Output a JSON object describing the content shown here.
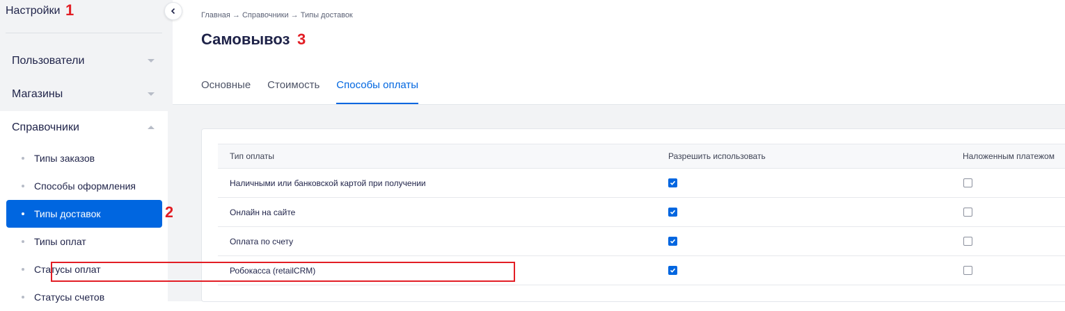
{
  "sidebar": {
    "title": "Настройки",
    "annotation_1": "1",
    "groups": [
      {
        "label": "Пользователи",
        "expanded": false
      },
      {
        "label": "Магазины",
        "expanded": false
      },
      {
        "label": "Справочники",
        "expanded": true
      }
    ],
    "subitems": [
      {
        "label": "Типы заказов",
        "active": false
      },
      {
        "label": "Способы оформления",
        "active": false
      },
      {
        "label": "Типы доставок",
        "active": true
      },
      {
        "label": "Типы оплат",
        "active": false
      },
      {
        "label": "Статусы оплат",
        "active": false
      },
      {
        "label": "Статусы счетов",
        "active": false
      }
    ],
    "annotation_2": "2",
    "collapse_icon": "chevron-left-icon"
  },
  "header": {
    "breadcrumb": "Главная → Справочники → Типы доставок",
    "title": "Самовывоз",
    "annotation_3": "3"
  },
  "tabs": [
    {
      "label": "Основные",
      "active": false
    },
    {
      "label": "Стоимость",
      "active": false
    },
    {
      "label": "Способы оплаты",
      "active": true
    }
  ],
  "table": {
    "columns": [
      "Тип оплаты",
      "Разрешить использовать",
      "Наложенным платежом"
    ],
    "rows": [
      {
        "name": "Наличными или банковской картой при получении",
        "allow": true,
        "cod": false
      },
      {
        "name": "Онлайн на сайте",
        "allow": true,
        "cod": false
      },
      {
        "name": "Оплата по счету",
        "allow": true,
        "cod": false
      },
      {
        "name": "Робокасса (retailCRM)",
        "allow": true,
        "cod": false,
        "highlighted": true
      }
    ]
  },
  "colors": {
    "accent": "#0066e0",
    "annotation": "#e21d24",
    "sidebar_bg": "#f2f3f5"
  }
}
